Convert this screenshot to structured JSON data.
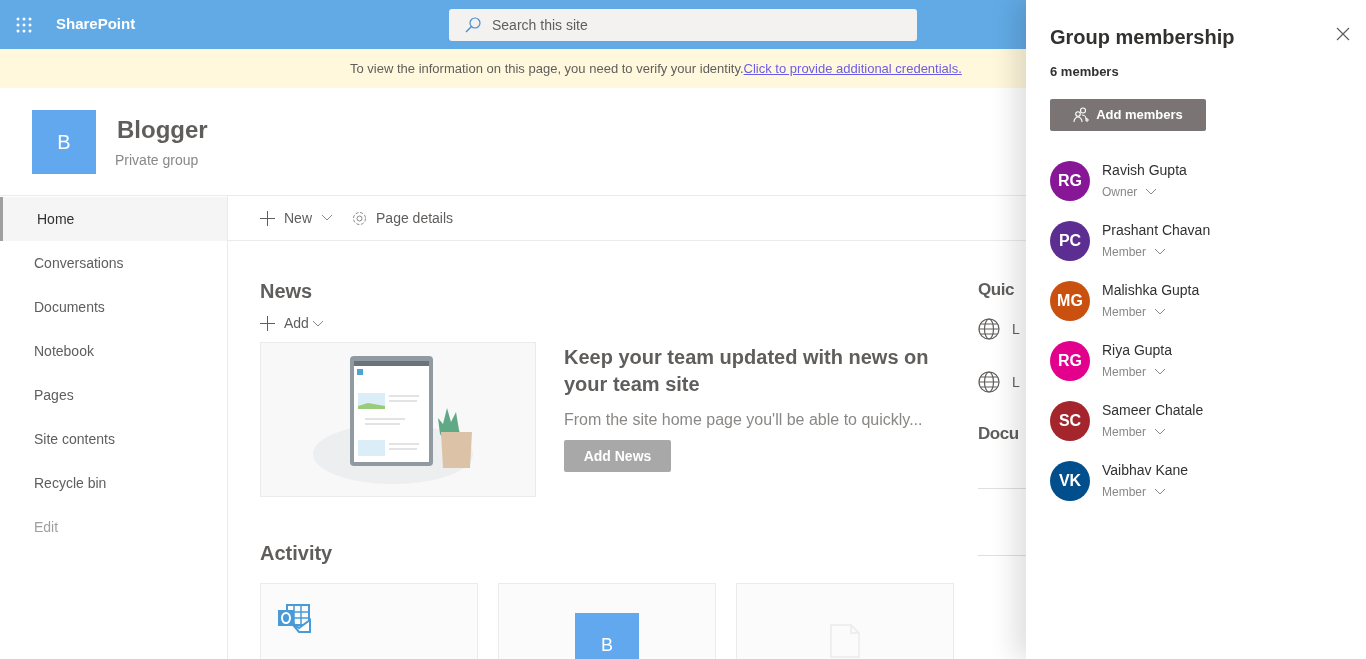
{
  "top_bar": {
    "app_name": "SharePoint",
    "search": {
      "placeholder": "Search this site"
    }
  },
  "notice": {
    "text": "To view the information on this page, you need to verify your identity.",
    "link": "Click to provide additional credentials."
  },
  "site": {
    "logo_letter": "B",
    "title": "Blogger",
    "subtitle": "Private group"
  },
  "nav": {
    "items": [
      {
        "label": "Home",
        "selected": true,
        "disabled": false
      },
      {
        "label": "Conversations",
        "selected": false,
        "disabled": false
      },
      {
        "label": "Documents",
        "selected": false,
        "disabled": false
      },
      {
        "label": "Notebook",
        "selected": false,
        "disabled": false
      },
      {
        "label": "Pages",
        "selected": false,
        "disabled": false
      },
      {
        "label": "Site contents",
        "selected": false,
        "disabled": false
      },
      {
        "label": "Recycle bin",
        "selected": false,
        "disabled": false
      },
      {
        "label": "Edit",
        "selected": false,
        "disabled": true
      }
    ]
  },
  "command_bar": [
    {
      "kind": "new",
      "label": "New"
    },
    {
      "kind": "details",
      "label": "Page details"
    }
  ],
  "news": {
    "title": "News",
    "add_label": "Add",
    "card": {
      "headline": "Keep your team updated with news on your team site",
      "summary": "From the site home page you'll be able to quickly...",
      "button": "Add News"
    }
  },
  "activity": {
    "title": "Activity",
    "cards": [
      {
        "kind": "outlook"
      },
      {
        "kind": "site",
        "letter": "B"
      },
      {
        "kind": "document"
      }
    ]
  },
  "quick_links": {
    "title": "Quic",
    "links": [
      "L",
      "L"
    ]
  },
  "documents": {
    "title": "Docu"
  },
  "panel": {
    "title": "Group membership",
    "count": "6 members",
    "add_button": "Add members",
    "members": [
      {
        "initials": "RG",
        "name": "Ravish Gupta",
        "role": "Owner",
        "color": "#881798"
      },
      {
        "initials": "PC",
        "name": "Prashant Chavan",
        "role": "Member",
        "color": "#5c2e91"
      },
      {
        "initials": "MG",
        "name": "Malishka Gupta",
        "role": "Member",
        "color": "#ca5010"
      },
      {
        "initials": "RG",
        "name": "Riya Gupta",
        "role": "Member",
        "color": "#e3008c"
      },
      {
        "initials": "SC",
        "name": "Sameer Chatale",
        "role": "Member",
        "color": "#a4262c"
      },
      {
        "initials": "VK",
        "name": "Vaibhav Kane",
        "role": "Member",
        "color": "#004e8c"
      }
    ]
  }
}
